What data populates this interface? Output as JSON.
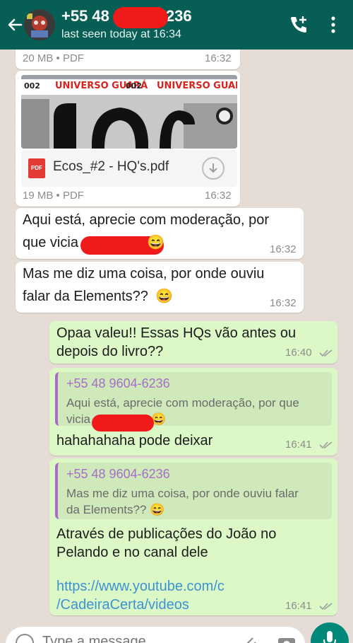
{
  "header": {
    "back_icon": "arrow-left-icon",
    "title_start": "+55 48",
    "title_end": "236",
    "last_seen": "last seen today at 16:34",
    "call_icon": "add-call-icon",
    "menu_icon": "more-vert-icon",
    "colors": {
      "bar": "#075e54",
      "redaction": "#f01a1a"
    }
  },
  "messages": [
    {
      "type": "doc-footer",
      "size": "20 MB • PDF",
      "time": "16:32"
    },
    {
      "type": "document",
      "thumbnail": {
        "band_num": "002",
        "band_text": "UNIVERSO GUARÁ",
        "big_text": "ECOS"
      },
      "file_icon_label": "PDF",
      "file_name": "Ecos_#2 - HQ's.pdf",
      "download_icon": "download-icon",
      "size": "19 MB • PDF",
      "time": "16:32"
    },
    {
      "type": "incoming",
      "line1": "Aqui está, aprecie com moderação, por",
      "line2": "que vicia",
      "emoji": "😄",
      "time": "16:32"
    },
    {
      "type": "incoming",
      "line1": "Mas me diz uma coisa, por onde ouviu",
      "line2": "falar da Elements??",
      "emoji": "😄",
      "time": "16:32"
    },
    {
      "type": "outgoing",
      "line1": "Opaa valeu!! Essas HQs vão antes ou",
      "line2": "depois do livro??",
      "time": "16:40"
    },
    {
      "type": "outgoing-reply",
      "quote_author": "+55 48 9604-6236",
      "quote_line1": "Aqui está, aprecie com moderação, por que",
      "quote_line2": "vicia",
      "quote_emoji": "😄",
      "text": "hahahahaha pode deixar",
      "time": "16:41"
    },
    {
      "type": "outgoing-reply",
      "quote_author": "+55 48 9604-6236",
      "quote_line1": "Mas me diz uma coisa, por onde ouviu falar",
      "quote_line2": "da Elements??",
      "quote_emoji": "😄",
      "text_line1": "Através de publicações do João no",
      "text_line2": "Pelando e no canal dele",
      "link_line1": "https://www.youtube.com/c",
      "link_line2": "/CadeiraCerta/videos",
      "time": "16:41"
    }
  ],
  "input": {
    "placeholder": "Type a message",
    "emoji_icon": "emoji-icon",
    "attach_icon": "paperclip-icon",
    "camera_icon": "camera-icon",
    "mic_icon": "mic-icon"
  }
}
